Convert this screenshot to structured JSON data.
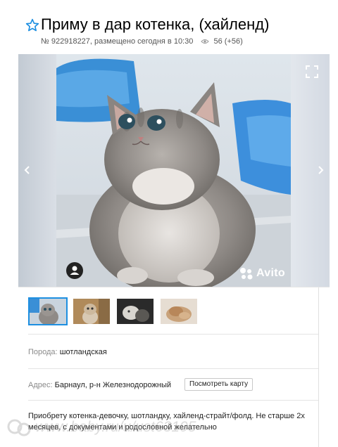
{
  "listing": {
    "title": "Приму в дар котенка, (хайленд)",
    "meta_number": "№ 922918227, размещено сегодня в 10:30",
    "views": "56 (+56)"
  },
  "gallery": {
    "brand": "Avito",
    "thumbnail_count": 4,
    "active_thumbnail": 1
  },
  "details": {
    "breed_label": "Порода:",
    "breed_value": "шотландская",
    "address_label": "Адрес:",
    "address_value": "Барнаул, р-н Железнодорожный",
    "map_button": "Посмотреть карту"
  },
  "description": {
    "text": "Приобрету котенка-девочку, шотландку, хайленд-страйт/фолд. Не старше 2х месяцев, с документами и родословной желательно"
  },
  "watermark": {
    "text": "www.baby.ru/u/ust63105"
  },
  "icons": {
    "star": "star-outline-icon",
    "views": "eye-icon",
    "fullscreen": "fullscreen-icon",
    "user": "user-icon",
    "prev": "chevron-left-icon",
    "next": "chevron-right-icon"
  },
  "colors": {
    "accent": "#1d8fe1",
    "meta_text": "#555555",
    "label_text": "#8a8a8a"
  }
}
